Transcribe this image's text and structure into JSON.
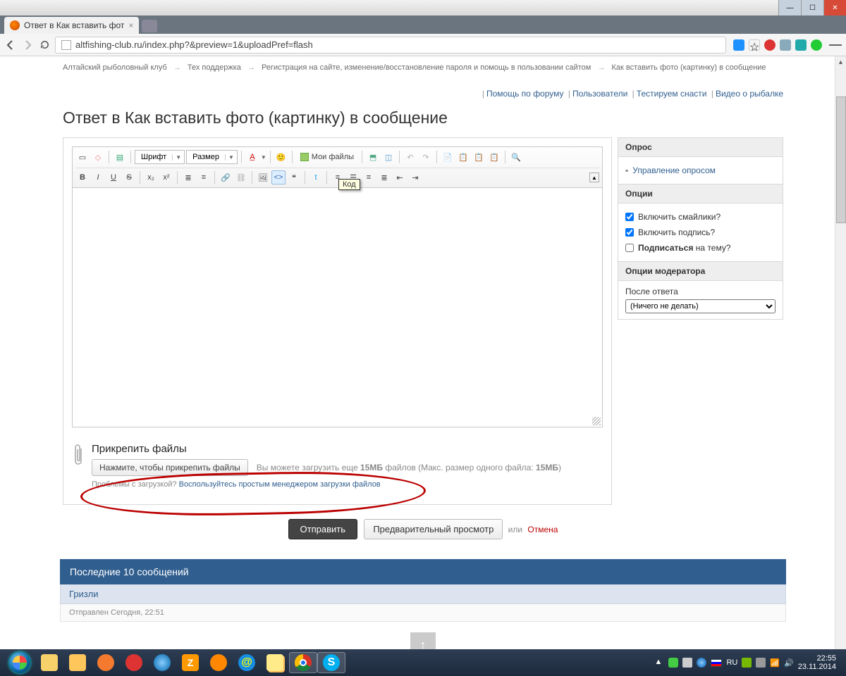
{
  "window": {
    "tab_title": "Ответ в Как вставить фот",
    "win_min": "—",
    "win_max": "☐",
    "win_close": "✕"
  },
  "addr": {
    "url": "altfishing-club.ru/index.php?&preview=1&uploadPref=flash"
  },
  "breadcrumb": {
    "a": "Алтайский рыболовный клуб",
    "b": "Тех поддержка",
    "c": "Регистрация на сайте, изменение/восстановление пароля и помощь в пользовании сайтом",
    "d": "Как вставить фото (картинку) в сообщение"
  },
  "topmenu": {
    "a": "Помощь по форуму",
    "b": "Пользователи",
    "c": "Тестируем снасти",
    "d": "Видео о рыбалке"
  },
  "title": "Ответ в Как вставить фото (картинку) в сообщение",
  "toolbar": {
    "font_label": "Шрифт",
    "size_label": "Размер",
    "myfiles": "Мои файлы",
    "tooltip": "Код"
  },
  "sidebar": {
    "poll_head": "Опрос",
    "poll_manage": "Управление опросом",
    "opt_head": "Опции",
    "opt_smiles": "Включить смайлики?",
    "opt_sig": "Включить подпись?",
    "opt_sub_a": "Подписаться",
    "opt_sub_b": " на тему?",
    "mod_head": "Опции модератора",
    "after_label": "После ответа",
    "after_sel": "(Ничего не делать)"
  },
  "attach": {
    "head": "Прикрепить файлы",
    "btn": "Нажмите, чтобы прикрепить файлы",
    "hint_a": "Вы можете загрузить еще ",
    "hint_b": "15МБ",
    "hint_c": " файлов (Макс. размер одного файла: ",
    "hint_d": "15МБ",
    "hint_e": ")",
    "prob_a": "Проблемы с загрузкой? ",
    "prob_link": "Воспользуйтесь простым менеджером загрузки файлов"
  },
  "submit": {
    "send": "Отправить",
    "preview": "Предварительный просмотр",
    "or": "или ",
    "cancel": "Отмена"
  },
  "last": {
    "head": "Последние 10 сообщений",
    "author": "Гризли",
    "meta": "Отправлен Сегодня, 22:51"
  },
  "status": "javascript:void('Код')",
  "tray": {
    "time": "22:55",
    "date": "23.11.2014",
    "lang": "RU"
  }
}
